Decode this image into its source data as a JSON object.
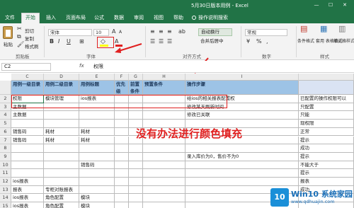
{
  "window": {
    "title": "5月30日版本用例 - Excel",
    "controls": [
      "—",
      "☐",
      "✕"
    ]
  },
  "tabs": [
    "文件",
    "开始",
    "插入",
    "页面布局",
    "公式",
    "数据",
    "审阅",
    "视图",
    "帮助",
    "操作说明搜索"
  ],
  "active_tab": "开始",
  "ribbon": {
    "clipboard": {
      "paste": "粘贴",
      "cut": "剪切",
      "copy": "复制",
      "format_painter": "格式刷",
      "group_label": "剪贴板"
    },
    "font": {
      "font_name": "宋体",
      "font_size": "10",
      "bold": "B",
      "italic": "I",
      "underline": "U",
      "grow": "A",
      "shrink": "A",
      "group_label": "字体"
    },
    "alignment": {
      "wrap_text": "自动换行",
      "merge_center": "合并后居中",
      "group_label": "对齐方式"
    },
    "number": {
      "format": "常规",
      "percent": "%",
      "comma": ",",
      "group_label": "数字"
    },
    "styles": {
      "conditional": "条件格式",
      "table": "套用\n表格格式",
      "cell_styles": "单元格样式",
      "group_label": "样式"
    }
  },
  "formula_bar": {
    "name_box": "C2",
    "fx": "fx",
    "value": "权限"
  },
  "columns": [
    "C",
    "D",
    "E",
    "F",
    "G",
    "H",
    "I"
  ],
  "header_row": [
    "用例一级目录",
    "用例二级目录",
    "用例标题",
    "优先级",
    "前置条件",
    "预置条件",
    "操作步骤"
  ],
  "rows": [
    {
      "num": "2",
      "cells": [
        "权限",
        "模块管理",
        "ios报表",
        "",
        "",
        "",
        "给ios的相关报表配置权"
      ]
    },
    {
      "num": "3",
      "cells": [
        "主数据",
        "",
        "",
        "",
        "",
        "",
        "修改某天刷新时间"
      ]
    },
    {
      "num": "4",
      "cells": [
        "主数据",
        "",
        "",
        "",
        "",
        "",
        "修改已关联"
      ]
    },
    {
      "num": "5",
      "cells": [
        "",
        "",
        "",
        "",
        "",
        "",
        ""
      ]
    },
    {
      "num": "6",
      "cells": [
        "销售码",
        "耗材",
        "耗材",
        "",
        "",
        "",
        ""
      ]
    },
    {
      "num": "7",
      "cells": [
        "销售码",
        "耗材",
        "耗材",
        "",
        "",
        "",
        ""
      ]
    },
    {
      "num": "8",
      "cells": [
        "",
        "",
        "",
        "",
        "",
        "",
        ""
      ]
    },
    {
      "num": "9",
      "cells": [
        "",
        "",
        "",
        "",
        "",
        "",
        "录入库价为0，售价不为0"
      ]
    },
    {
      "num": "10",
      "cells": [
        "",
        "",
        "销售码",
        "",
        "",
        "",
        ""
      ]
    },
    {
      "num": "11",
      "cells": [
        "",
        "",
        "",
        "",
        "",
        "",
        ""
      ]
    },
    {
      "num": "12",
      "cells": [
        "ios报表",
        "",
        "",
        "",
        "",
        "",
        ""
      ]
    },
    {
      "num": "13",
      "cells": [
        "报表",
        "专柜对账报表",
        "",
        "",
        "",
        "",
        ""
      ]
    },
    {
      "num": "14",
      "cells": [
        "ios报表",
        "角色配置",
        "模块",
        "",
        "",
        "",
        ""
      ]
    },
    {
      "num": "15",
      "cells": [
        "ios报表",
        "角色配置",
        "模块",
        "",
        "",
        "",
        ""
      ]
    }
  ],
  "right_notes": [
    "已配置的操作权限可以",
    "只配置",
    "只能",
    "现权限",
    "正常",
    "提示",
    "成功",
    "提示",
    "不能大于",
    "提示",
    "报表",
    "成功"
  ],
  "annotation": {
    "message": "没有办法进行颜色填充"
  },
  "watermark": {
    "logo": "10",
    "brand": "Win10 系统家园",
    "url": "www.qdhuajin.com"
  },
  "colors": {
    "excel_green": "#217346",
    "annotation_red": "#e02020",
    "header_blue": "#9dc3e6",
    "fill_yellow": "#ffff00"
  }
}
